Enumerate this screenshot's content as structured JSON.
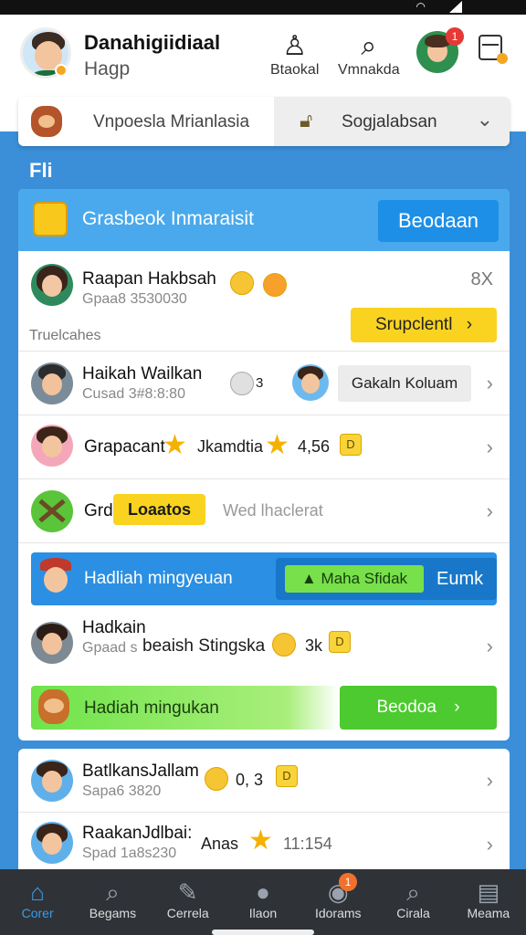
{
  "header": {
    "name": "Danahigiidiaal",
    "sub": "Hagp",
    "icons": [
      {
        "name": "person-icon",
        "label": "Btaokal"
      },
      {
        "name": "search-people-icon",
        "label": "Vmnakda"
      }
    ],
    "notif_count": "1"
  },
  "picker": {
    "left_label": "Vnpoesla Mrianlasia",
    "right_label": "Sogjalabsan"
  },
  "section_title": "Fli",
  "card": {
    "head_title": "Grasbeok Inmaraisit",
    "head_button": "Beodaan",
    "first": {
      "name": "Raapan Hakbsah",
      "sub": "Gpaa8 3530030",
      "close": "8X",
      "button": "Srupclentl",
      "section_label": "Truelcahes"
    },
    "rows": [
      {
        "name": "Haikah Wailkan",
        "sub": "Cusad 3#8:8:80",
        "mid": "3",
        "button": "Gakaln Koluam"
      },
      {
        "name": "Grapacant",
        "mid": "Jkamdtia",
        "value": "4,56",
        "coin": "D"
      },
      {
        "name": "Grd",
        "tag": "Loaatos",
        "mid": "Wed lhaclerat"
      }
    ],
    "blue_banner": {
      "label": "Hadliah mingyeuan",
      "button": "Maha Sfidak",
      "extra": "Eumk"
    },
    "row_after_banner": {
      "name": "Hadkain",
      "sub": "Gpaad s",
      "mid": "beaish Stingska",
      "value": "3k",
      "coin": "D"
    },
    "green_banner": {
      "label": "Hadiah mingukan",
      "button": "Beodoa"
    }
  },
  "card2": {
    "rows": [
      {
        "name": "BatlkansJallam",
        "sub": "Sapa6 3820",
        "value": "0, 3",
        "coin": "D"
      },
      {
        "name": "RaakanJdlbai:",
        "sub": "Spad 1a8s230",
        "mid": "Anas",
        "value": "11:154"
      }
    ]
  },
  "nav": [
    {
      "icon": "home-icon",
      "label": "Corer"
    },
    {
      "icon": "search-icon",
      "label": "Begams"
    },
    {
      "icon": "edit-icon",
      "label": "Cerrela"
    },
    {
      "icon": "chat-icon",
      "label": "Ilaon"
    },
    {
      "icon": "inbox-icon",
      "label": "Idorams",
      "badge": "1"
    },
    {
      "icon": "explore-icon",
      "label": "Cirala"
    },
    {
      "icon": "menu-icon",
      "label": "Meama"
    }
  ],
  "colors": {
    "primary": "#3a8fd8",
    "accent_yellow": "#f9d31f",
    "accent_green": "#5fd83f",
    "nav_bg": "#2f3338"
  }
}
